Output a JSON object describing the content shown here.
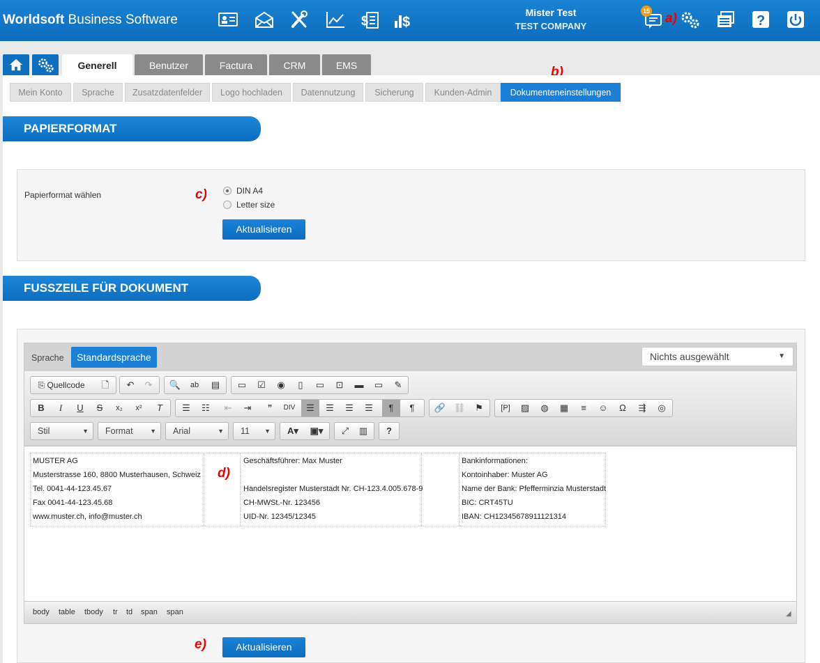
{
  "app": {
    "brand_bold": "Worldsoft",
    "brand_rest": " Business Software"
  },
  "user": {
    "name": "Mister Test",
    "company": "TEST COMPANY"
  },
  "notifications": {
    "count": "15"
  },
  "annotations": {
    "a": "a)",
    "b": "b)",
    "c": "c)",
    "d": "d)",
    "e": "e)"
  },
  "main_tabs": [
    "Generell",
    "Benutzer",
    "Factura",
    "CRM",
    "EMS"
  ],
  "sub_tabs": [
    "Mein Konto",
    "Sprache",
    "Zusatzdatenfelder",
    "Logo hochladen",
    "Datennutzung",
    "Sicherung",
    "Kunden-Admin",
    "Dokumenteneinstellungen"
  ],
  "paper": {
    "title": "PAPIERFORMAT",
    "label": "Papierformat wählen",
    "options": [
      "DIN A4",
      "Letter size"
    ],
    "selected": "DIN A4",
    "button": "Aktualisieren"
  },
  "footer": {
    "title": "FUSSZEILE FÜR DOKUMENT",
    "language_label": "Sprache",
    "language_button": "Standardsprache",
    "dropdown": "Nichts ausgewählt",
    "source_label": "Quellcode",
    "styles": {
      "stil": "Stil",
      "format": "Format",
      "font": "Arial",
      "size": "11"
    },
    "col1": [
      "MUSTER AG",
      "Musterstrasse 160, 8800 Musterhausen, Schweiz",
      "Tel. 0041-44-123.45.67",
      "Fax 0041-44-123.45.68",
      "www.muster.ch, info@muster.ch"
    ],
    "col2": [
      "Geschäftsführer: Max Muster",
      "",
      "Handelsregister Musterstadt Nr. CH-123.4.005.678-9",
      "CH-MWSt.-Nr. 123456",
      "UID-Nr. 12345/12345"
    ],
    "col3": [
      "Bankinformationen:",
      "Kontoinhaber: Muster AG",
      "Name der Bank: Pfefferminzia Musterstadt",
      "BIC: CRT45TU",
      "IBAN: CH12345678911121314"
    ],
    "path": [
      "body",
      "table",
      "tbody",
      "tr",
      "td",
      "span",
      "span"
    ],
    "button": "Aktualisieren"
  }
}
